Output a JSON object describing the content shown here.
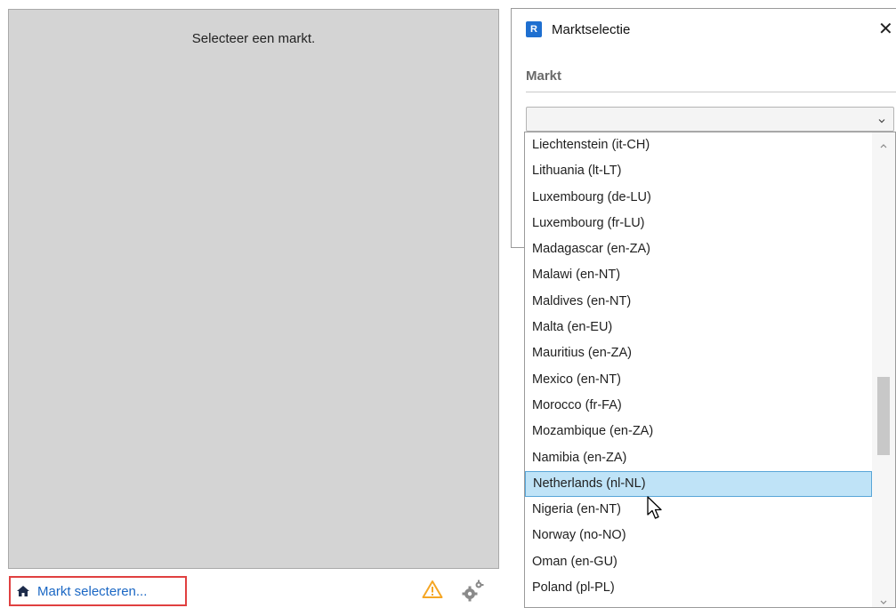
{
  "left_panel": {
    "message": "Selecteer een markt."
  },
  "status_bar": {
    "link_label": "Markt selecteren...",
    "icons": [
      "home-icon",
      "warning-icon",
      "gear-icon"
    ]
  },
  "dialog": {
    "title": "Marktselectie",
    "app_icon_letter": "R",
    "field_label": "Markt",
    "select_value": ""
  },
  "dropdown": {
    "items": [
      "Liechtenstein (it-CH)",
      "Lithuania (lt-LT)",
      "Luxembourg (de-LU)",
      "Luxembourg (fr-LU)",
      "Madagascar (en-ZA)",
      "Malawi (en-NT)",
      "Maldives (en-NT)",
      "Malta (en-EU)",
      "Mauritius (en-ZA)",
      "Mexico (en-NT)",
      "Morocco (fr-FA)",
      "Mozambique (en-ZA)",
      "Namibia (en-ZA)",
      "Netherlands (nl-NL)",
      "Nigeria (en-NT)",
      "Norway (no-NO)",
      "Oman (en-GU)",
      "Poland (pl-PL)"
    ],
    "selected": "Netherlands (nl-NL)"
  },
  "colors": {
    "link": "#1a67c4",
    "highlight": "#bfe3f7",
    "highlight_border": "#58a6d8",
    "warning": "#f5a623",
    "red_outline": "#e04040"
  }
}
